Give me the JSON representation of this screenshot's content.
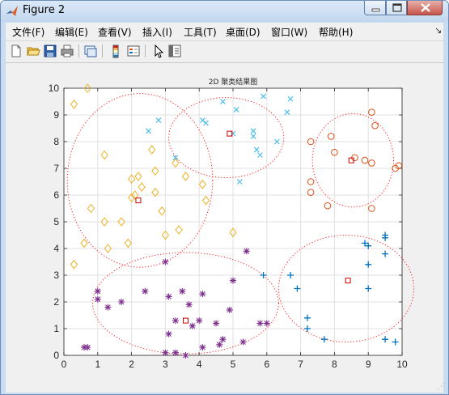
{
  "window": {
    "title": "Figure 2"
  },
  "menu": [
    "文件(F)",
    "编辑(E)",
    "查看(V)",
    "插入(I)",
    "工具(T)",
    "桌面(D)",
    "窗口(W)",
    "帮助(H)"
  ],
  "toolbar_icons": [
    "new-figure-icon",
    "open-icon",
    "save-icon",
    "print-icon",
    "link-icon",
    "colorbar-icon",
    "legend-icon",
    "pointer-icon",
    "property-editor-icon"
  ],
  "chart_data": {
    "type": "scatter",
    "title": "2D 聚类结果图",
    "xlabel": "",
    "ylabel": "",
    "xlim": [
      0,
      10
    ],
    "ylim": [
      0,
      10
    ],
    "xticks": [
      "0",
      "1",
      "2",
      "3",
      "4",
      "5",
      "6",
      "7",
      "8",
      "9",
      "10"
    ],
    "yticks": [
      "0",
      "1",
      "2",
      "3",
      "4",
      "5",
      "6",
      "7",
      "8",
      "9",
      "10"
    ],
    "grid": true,
    "series": [
      {
        "marker": "diamond",
        "color": "#edb120",
        "points": [
          [
            0.3,
            9.4
          ],
          [
            0.7,
            10.0
          ],
          [
            1.2,
            7.5
          ],
          [
            0.8,
            5.5
          ],
          [
            1.2,
            5.0
          ],
          [
            1.7,
            5.0
          ],
          [
            0.6,
            4.2
          ],
          [
            1.3,
            4.0
          ],
          [
            1.9,
            4.2
          ],
          [
            0.3,
            3.4
          ],
          [
            2.0,
            6.6
          ],
          [
            2.2,
            6.7
          ],
          [
            2.6,
            7.7
          ],
          [
            2.7,
            6.9
          ],
          [
            2.1,
            6.0
          ],
          [
            2.3,
            6.3
          ],
          [
            2.0,
            5.9
          ],
          [
            2.7,
            6.1
          ],
          [
            2.9,
            5.4
          ],
          [
            3.0,
            4.5
          ],
          [
            3.4,
            4.7
          ],
          [
            3.3,
            7.2
          ],
          [
            3.6,
            6.7
          ],
          [
            4.1,
            6.4
          ],
          [
            4.2,
            5.8
          ],
          [
            5.0,
            4.6
          ]
        ]
      },
      {
        "marker": "x",
        "color": "#4dbeee",
        "points": [
          [
            2.5,
            8.4
          ],
          [
            2.8,
            8.8
          ],
          [
            3.3,
            7.4
          ],
          [
            4.1,
            8.8
          ],
          [
            4.2,
            8.7
          ],
          [
            4.7,
            9.5
          ],
          [
            5.0,
            8.3
          ],
          [
            5.1,
            9.2
          ],
          [
            5.6,
            8.4
          ],
          [
            5.6,
            8.2
          ],
          [
            5.7,
            7.7
          ],
          [
            5.8,
            7.5
          ],
          [
            5.9,
            9.7
          ],
          [
            6.3,
            8.0
          ],
          [
            6.6,
            9.1
          ],
          [
            6.7,
            9.6
          ],
          [
            5.2,
            6.5
          ]
        ]
      },
      {
        "marker": "circle",
        "color": "#d95319",
        "points": [
          [
            7.3,
            8.0
          ],
          [
            7.9,
            8.2
          ],
          [
            8.0,
            7.6
          ],
          [
            7.3,
            6.5
          ],
          [
            7.3,
            6.1
          ],
          [
            7.8,
            5.6
          ],
          [
            8.6,
            7.4
          ],
          [
            8.9,
            7.3
          ],
          [
            9.1,
            7.2
          ],
          [
            9.1,
            9.1
          ],
          [
            9.2,
            8.6
          ],
          [
            9.8,
            7.0
          ],
          [
            9.9,
            7.1
          ],
          [
            9.1,
            5.5
          ]
        ]
      },
      {
        "marker": "plus",
        "color": "#0072bd",
        "points": [
          [
            5.9,
            3.0
          ],
          [
            6.7,
            3.0
          ],
          [
            6.9,
            2.5
          ],
          [
            7.2,
            1.4
          ],
          [
            7.2,
            1.0
          ],
          [
            7.7,
            0.6
          ],
          [
            9.0,
            4.1
          ],
          [
            9.0,
            3.4
          ],
          [
            9.0,
            2.5
          ],
          [
            9.5,
            4.5
          ],
          [
            9.5,
            4.4
          ],
          [
            9.5,
            3.8
          ],
          [
            9.5,
            0.6
          ],
          [
            9.8,
            0.5
          ],
          [
            8.9,
            4.2
          ]
        ]
      },
      {
        "marker": "star",
        "color": "#7e2f8e",
        "points": [
          [
            0.6,
            0.3
          ],
          [
            0.7,
            0.3
          ],
          [
            1.0,
            2.4
          ],
          [
            1.0,
            2.1
          ],
          [
            1.3,
            1.8
          ],
          [
            1.7,
            2.0
          ],
          [
            2.4,
            2.4
          ],
          [
            3.0,
            3.5
          ],
          [
            3.1,
            2.2
          ],
          [
            3.1,
            0.8
          ],
          [
            3.0,
            0.1
          ],
          [
            3.3,
            1.3
          ],
          [
            3.3,
            0.1
          ],
          [
            3.5,
            2.4
          ],
          [
            3.6,
            0.0
          ],
          [
            3.7,
            1.9
          ],
          [
            3.8,
            1.1
          ],
          [
            4.0,
            1.3
          ],
          [
            4.1,
            2.3
          ],
          [
            4.1,
            0.3
          ],
          [
            4.5,
            1.2
          ],
          [
            4.6,
            0.4
          ],
          [
            4.7,
            0.6
          ],
          [
            4.9,
            1.7
          ],
          [
            5.0,
            2.8
          ],
          [
            5.3,
            0.5
          ],
          [
            5.4,
            3.9
          ],
          [
            5.8,
            1.2
          ],
          [
            6.0,
            1.2
          ]
        ]
      }
    ],
    "centroids": [
      [
        2.2,
        5.8
      ],
      [
        4.9,
        8.3
      ],
      [
        8.5,
        7.3
      ],
      [
        8.4,
        2.8
      ],
      [
        3.6,
        1.3
      ]
    ],
    "centroid_color": "#cc0000",
    "cluster_ellipses": [
      {
        "cx": 2.25,
        "cy": 6.55,
        "rx": 2.15,
        "ry": 3.25
      },
      {
        "cx": 4.8,
        "cy": 8.15,
        "rx": 1.7,
        "ry": 1.5
      },
      {
        "cx": 8.55,
        "cy": 7.3,
        "rx": 1.2,
        "ry": 1.75
      },
      {
        "cx": 8.35,
        "cy": 2.5,
        "rx": 2.0,
        "ry": 2.0
      },
      {
        "cx": 3.6,
        "cy": 1.95,
        "rx": 2.75,
        "ry": 1.9
      }
    ],
    "ellipse_color": "#ff2020"
  }
}
